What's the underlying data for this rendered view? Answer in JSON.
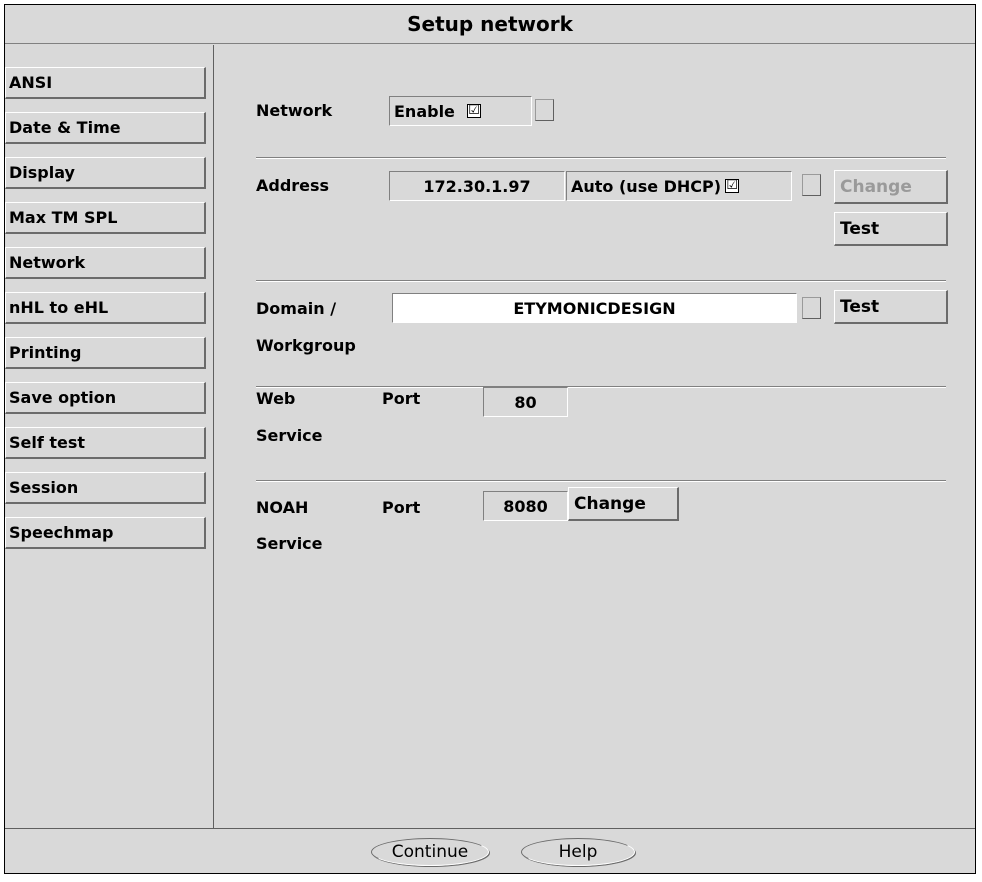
{
  "window": {
    "title": "Setup network"
  },
  "sidebar": {
    "items": [
      {
        "label": "ANSI"
      },
      {
        "label": "Date & Time"
      },
      {
        "label": "Display"
      },
      {
        "label": "Max TM SPL"
      },
      {
        "label": "Network"
      },
      {
        "label": "nHL to eHL"
      },
      {
        "label": "Printing"
      },
      {
        "label": "Save option"
      },
      {
        "label": "Self test"
      },
      {
        "label": "Session"
      },
      {
        "label": "Speechmap"
      }
    ]
  },
  "network": {
    "label": "Network",
    "enable_label": "Enable",
    "enable_checked": "☑"
  },
  "address": {
    "label": "Address",
    "value": "172.30.1.97",
    "dhcp_label": "Auto (use DHCP)",
    "dhcp_checked": "☑",
    "change_label": "Change",
    "test_label": "Test"
  },
  "domain": {
    "label_line1": "Domain /",
    "label_line2": "Workgroup",
    "value": "ETYMONICDESIGN",
    "test_label": "Test"
  },
  "web": {
    "label_line1": "Web",
    "label_line2": "Service",
    "port_label": "Port",
    "port_value": "80"
  },
  "noah": {
    "label_line1": "NOAH",
    "label_line2": "Service",
    "port_label": "Port",
    "port_value": "8080",
    "change_label": "Change"
  },
  "footer": {
    "continue_label": "Continue",
    "help_label": "Help"
  }
}
